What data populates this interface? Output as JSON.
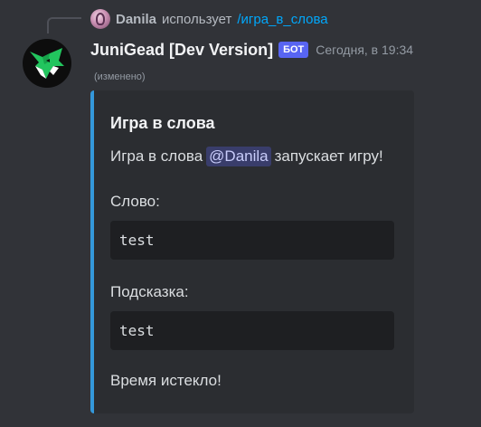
{
  "reply": {
    "username": "Danila",
    "action_text": "использует",
    "command": "/игра_в_слова"
  },
  "message": {
    "bot_name": "JuniGead [Dev Version]",
    "bot_badge": "БОТ",
    "timestamp": "Сегодня, в 19:34",
    "edited_label": "(изменено)"
  },
  "embed": {
    "accent_color": "#3498db",
    "title": "Игра в слова",
    "description_prefix": "Игра в слова",
    "mention": "@Danila",
    "description_suffix": "запускает игру!",
    "fields": [
      {
        "label": "Слово:",
        "value": "test"
      },
      {
        "label": "Подсказка:",
        "value": "test"
      }
    ],
    "footer_text": "Время истекло!"
  },
  "colors": {
    "background": "#313338",
    "embed_background": "#2b2d31",
    "code_background": "#1e1f22",
    "badge": "#5865f2",
    "command_link": "#00a8fc"
  },
  "icons": {
    "bot_avatar": "green-fox-logo-icon",
    "reply_avatar": "user-avatar-icon"
  }
}
